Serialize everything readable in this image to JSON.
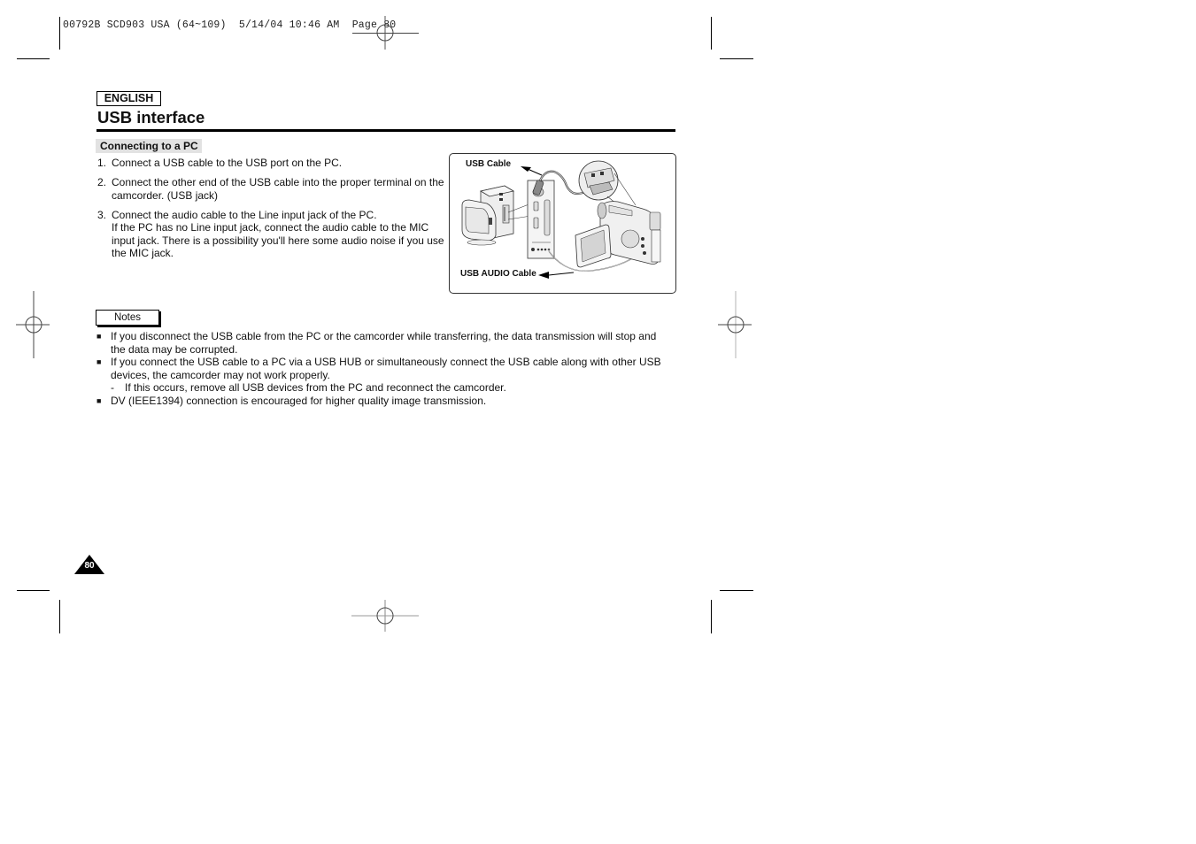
{
  "print_header": {
    "job": "00792B SCD903 USA (64~109)",
    "date": "5/14/04",
    "time": "10:46 AM",
    "page_label": "Page 80"
  },
  "language_badge": "ENGLISH",
  "page_title": "USB interface",
  "section": {
    "label": "Connecting to a PC",
    "steps": [
      {
        "num": "1.",
        "lines": [
          "Connect a USB cable to the USB port on the PC."
        ]
      },
      {
        "num": "2.",
        "lines": [
          "Connect the other end of the USB cable into the proper terminal on the camcorder. (USB jack)"
        ]
      },
      {
        "num": "3.",
        "lines": [
          "Connect the audio cable to the Line input jack of the PC.",
          "If the PC has no Line input jack, connect the audio cable to the MIC input jack. There is a possibility you'll here some audio noise if you use the MIC jack."
        ]
      }
    ]
  },
  "figure": {
    "usb_cable_label": "USB Cable",
    "usb_audio_cable_label": "USB AUDIO Cable",
    "icons": [
      "pc-tower-icon",
      "monitor-icon",
      "pc-rear-panel-icon",
      "camcorder-icon",
      "usb-jack-detail-icon"
    ]
  },
  "notes": {
    "tab_label": "Notes",
    "items": [
      {
        "text": "If you disconnect the USB cable from the PC or the camcorder while transferring, the data transmission will stop and the data may be corrupted.",
        "sub": []
      },
      {
        "text": "If you connect the USB cable to a PC via a USB HUB or simultaneously connect the USB cable along with other USB devices, the camcorder may not work properly.",
        "sub": [
          "If this occurs, remove all USB devices from the PC and reconnect the camcorder."
        ]
      },
      {
        "text": "DV (IEEE1394) connection is encouraged for higher quality image transmission.",
        "sub": []
      }
    ]
  },
  "page_number": "80",
  "bullet_glyph": "■",
  "dash_glyph": "-"
}
